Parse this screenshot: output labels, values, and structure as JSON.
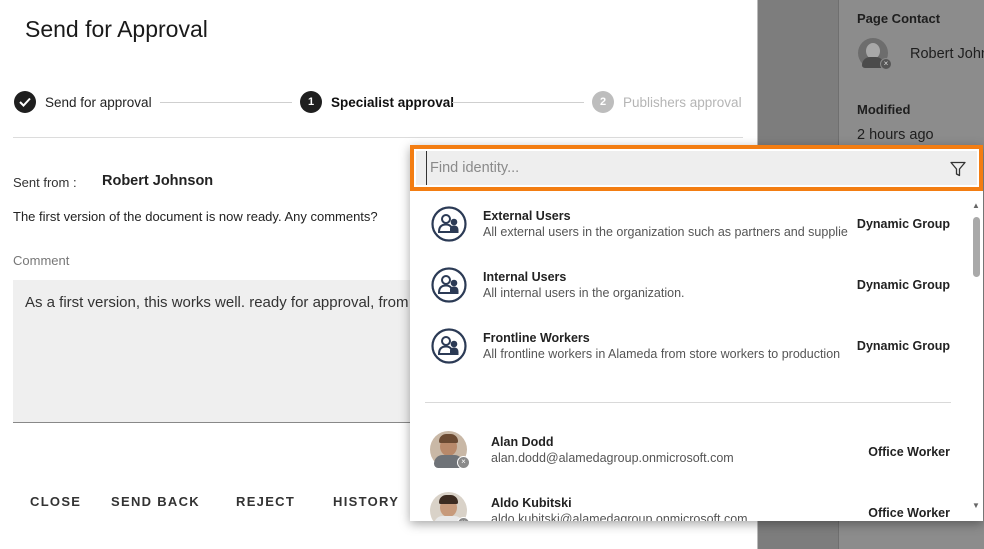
{
  "side_panel": {
    "page_contact_label": "Page Contact",
    "contact_name": "Robert Johnson",
    "modified_label": "Modified",
    "modified_value": "2 hours ago"
  },
  "dialog": {
    "title": "Send for Approval",
    "steps": [
      {
        "label": "Send for approval",
        "marker": "check-icon",
        "state": "completed"
      },
      {
        "label": "Specialist approval",
        "marker": "1",
        "state": "active"
      },
      {
        "label": "Publishers approval",
        "marker": "2",
        "state": "pending"
      }
    ],
    "sent_from_label": "Sent from :",
    "sent_from_name": "Robert Johnson",
    "message": "The first version of the document is now ready. Any comments?",
    "comment_label": "Comment",
    "comment_text": "As a first version, this works well. ready for approval, from my side.",
    "actions": {
      "close": "CLOSE",
      "send_back": "SEND BACK",
      "reject": "REJECT",
      "history": "HISTORY"
    }
  },
  "identity_picker": {
    "search": {
      "placeholder": "Find identity...",
      "value": ""
    },
    "accent_color": "#f37d12",
    "groups": [
      {
        "name": "External Users",
        "description": "All external users in the organization such as partners and supplie",
        "type": "Dynamic Group",
        "icon": "group-icon"
      },
      {
        "name": "Internal Users",
        "description": "All internal users in the organization.",
        "type": "Dynamic Group",
        "icon": "group-icon"
      },
      {
        "name": "Frontline Workers",
        "description": "All frontline workers in Alameda from store workers to production",
        "type": "Dynamic Group",
        "icon": "group-icon"
      }
    ],
    "users": [
      {
        "name": "Alan Dodd",
        "email": "alan.dodd@alamedagroup.onmicrosoft.com",
        "type": "Office Worker"
      },
      {
        "name": "Aldo Kubitski",
        "email": "aldo.kubitski@alamedagroup.onmicrosoft.com",
        "type": "Office Worker"
      }
    ]
  },
  "colors": {
    "step_completed": "#1f1f1f",
    "step_active": "#1f1f1f",
    "step_pending": "#bdbdbd"
  }
}
